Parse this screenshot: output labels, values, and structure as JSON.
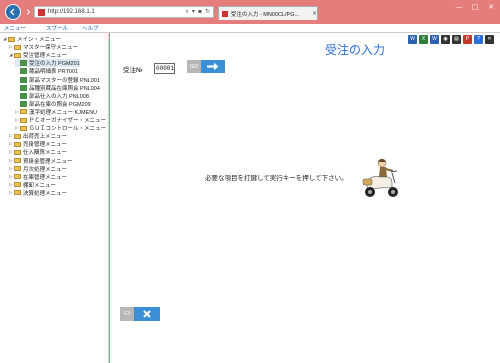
{
  "browser": {
    "url": "http://192.168.1.1",
    "tab_title": "受注の入力 - MN00CL/PG...",
    "tab_close": "×",
    "window_controls": [
      "—",
      "□",
      "✕"
    ]
  },
  "menubar": {
    "items": [
      "メニュー",
      "スプール",
      "ヘルプ"
    ]
  },
  "tree": {
    "items": [
      {
        "label": "メイン・メニュー",
        "type": "folder",
        "expanded": true
      },
      {
        "label": "マスター保守メニュー",
        "type": "folder"
      },
      {
        "label": "受注管理メニュー",
        "type": "folder",
        "expanded": true
      },
      {
        "label": "受注の入力 PGM201",
        "type": "doc",
        "selected": true
      },
      {
        "label": "蔵品明細表 PRT001",
        "type": "doc"
      },
      {
        "label": "部品マスターの登録 PNL001",
        "type": "doc"
      },
      {
        "label": "品種別蔵品在庫照会 PNL004",
        "type": "doc"
      },
      {
        "label": "部品仕入の入力 PNL008",
        "type": "doc"
      },
      {
        "label": "部品在庫の照会 PGM209",
        "type": "doc"
      },
      {
        "label": "漢字処理メニュー KJMENU",
        "type": "folder"
      },
      {
        "label": "ＰＣオーガナイザー・メニュー",
        "type": "folder"
      },
      {
        "label": "ＧＵＩコントロール・メニュー",
        "type": "folder"
      },
      {
        "label": "出荷売上メニュー",
        "type": "folder"
      },
      {
        "label": "売掛管理メニュー",
        "type": "folder"
      },
      {
        "label": "仕入購買メニュー",
        "type": "folder"
      },
      {
        "label": "買掛金管理メニュー",
        "type": "folder"
      },
      {
        "label": "月次処理メニュー",
        "type": "folder"
      },
      {
        "label": "在庫管理メニュー",
        "type": "folder"
      },
      {
        "label": "棚卸メニュー",
        "type": "folder"
      },
      {
        "label": "決算処理メニュー",
        "type": "folder"
      }
    ]
  },
  "app_icons": [
    {
      "name": "word",
      "color": "#2b5fb0",
      "text": "W"
    },
    {
      "name": "excel",
      "color": "#2f7d3a",
      "text": "X"
    },
    {
      "name": "powerpoint",
      "color": "#2b5fb0",
      "text": "W"
    },
    {
      "name": "camera",
      "color": "#333333",
      "text": "◉"
    },
    {
      "name": "printer",
      "color": "#333333",
      "text": "▤"
    },
    {
      "name": "pdf",
      "color": "#c0392b",
      "text": "P"
    },
    {
      "name": "help",
      "color": "#2e6fd8",
      "text": "?"
    },
    {
      "name": "close",
      "color": "#333333",
      "text": "✕"
    }
  ],
  "form": {
    "title": "受注の入力",
    "order_label": "受注№",
    "order_value": "00001",
    "go_label": "GO",
    "message": "必要な項目を打鍵して実行キーを押して下さい。",
    "f3_label": "F3"
  }
}
